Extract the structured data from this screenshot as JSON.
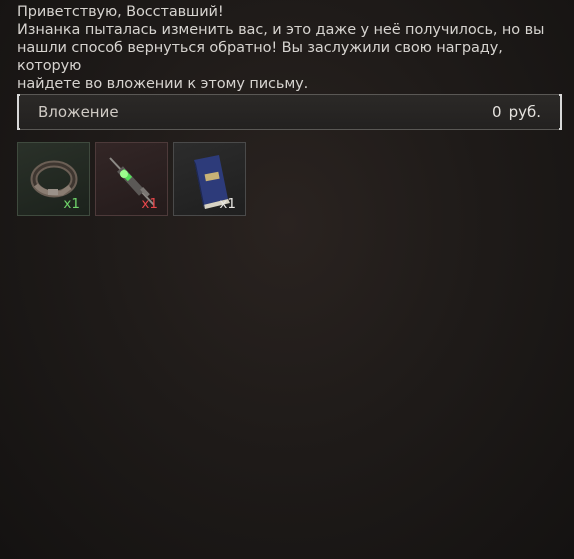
{
  "message": {
    "greeting": "Приветствую, Восставший!",
    "line1": "Изнанка пыталась изменить вас, и это даже у неё получилось, но вы",
    "line2": "нашли способ вернуться обратно! Вы заслужили свою награду, которую",
    "line3": "найдете во вложении к этому письму."
  },
  "attachment": {
    "label": "Вложение",
    "amount": "0",
    "currency": "руб."
  },
  "items": [
    {
      "icon": "belt-icon",
      "quantity": "x1",
      "rarity_color": "#6fd36a"
    },
    {
      "icon": "syringe-icon",
      "quantity": "x1",
      "rarity_color": "#e6474b"
    },
    {
      "icon": "book-icon",
      "quantity": "x1",
      "rarity_color": "#e8e6e3"
    }
  ]
}
